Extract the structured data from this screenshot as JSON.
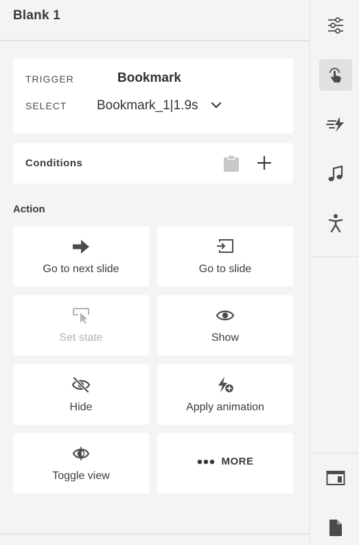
{
  "panel": {
    "title": "Blank 1"
  },
  "trigger": {
    "trigger_label": "TRIGGER",
    "trigger_value": "Bookmark",
    "select_label": "SELECT",
    "select_value": "Bookmark_1|1.9s"
  },
  "conditions": {
    "label": "Conditions"
  },
  "actions": {
    "section_label": "Action",
    "tiles": [
      {
        "label": "Go to next slide",
        "icon": "arrow-right-icon",
        "enabled": true
      },
      {
        "label": "Go to slide",
        "icon": "go-to-slide-icon",
        "enabled": true
      },
      {
        "label": "Set state",
        "icon": "set-state-icon",
        "enabled": false
      },
      {
        "label": "Show",
        "icon": "eye-icon",
        "enabled": true
      },
      {
        "label": "Hide",
        "icon": "eye-off-icon",
        "enabled": true
      },
      {
        "label": "Apply animation",
        "icon": "animation-add-icon",
        "enabled": true
      },
      {
        "label": "Toggle view",
        "icon": "toggle-view-icon",
        "enabled": true
      }
    ],
    "more_label": "MORE"
  },
  "rail": {
    "items": [
      {
        "icon": "properties-sliders-icon",
        "active": false
      },
      {
        "icon": "interaction-touch-icon",
        "active": true
      },
      {
        "icon": "animation-icon",
        "active": false
      },
      {
        "icon": "audio-note-icon",
        "active": false
      },
      {
        "icon": "accessibility-icon",
        "active": false
      },
      {
        "icon": "slide-layout-icon",
        "active": false
      },
      {
        "icon": "document-icon",
        "active": false
      }
    ]
  },
  "colors": {
    "background": "#f4f4f4",
    "card": "#ffffff",
    "icon": "#4b4b4b",
    "disabled": "#b3b3b3",
    "active_rail": "#e1e1e1"
  }
}
